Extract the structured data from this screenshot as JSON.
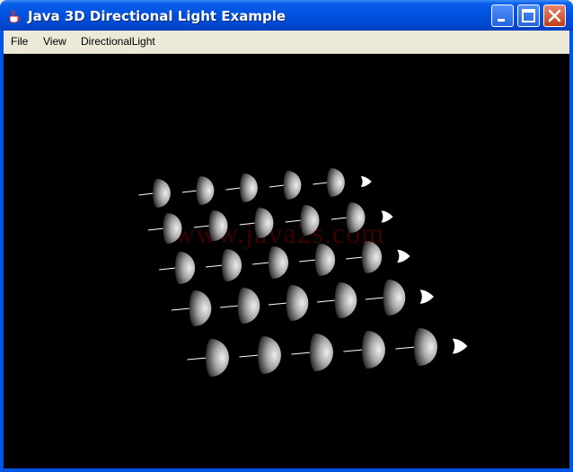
{
  "window": {
    "title": "Java 3D Directional Light Example"
  },
  "menu": {
    "items": [
      "File",
      "View",
      "DirectionalLight"
    ]
  },
  "canvas": {
    "watermark": "www.java2s.com"
  },
  "icons": {
    "app": "java-coffee-cup-icon",
    "minimize": "minimize-icon",
    "maximize": "maximize-icon",
    "close": "close-icon"
  },
  "colors": {
    "titlebar": "#0054e3",
    "canvas_background": "#000000",
    "menubar": "#ece9d8",
    "watermark": "#3a0000",
    "light_arrow": "#ffffff"
  }
}
